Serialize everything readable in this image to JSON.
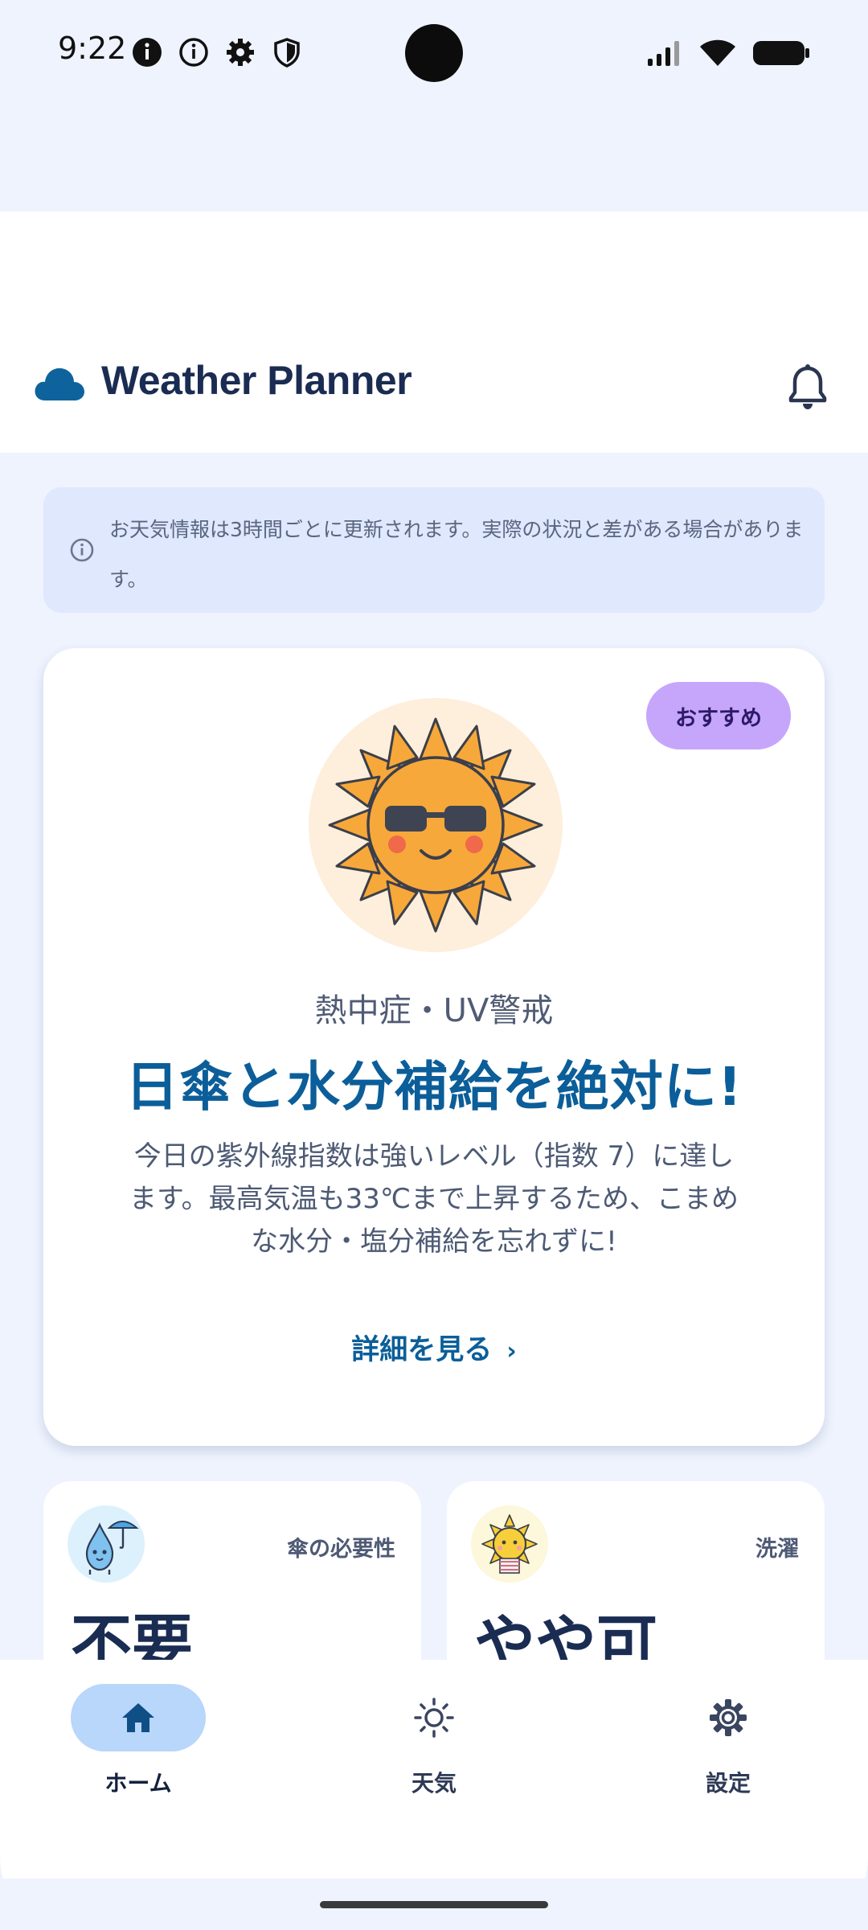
{
  "status_bar": {
    "time": "9:22",
    "left_icons": [
      "info-filled-icon",
      "info-outline-icon",
      "gear-icon",
      "shield-icon"
    ],
    "right_icons": [
      "signal-icon",
      "wifi-icon",
      "battery-icon"
    ]
  },
  "app_bar": {
    "title": "Weather Planner",
    "logo_icon": "cloud-icon",
    "notification_icon": "bell-icon"
  },
  "info_banner": {
    "icon": "info-outline-icon",
    "text": "お天気情報は3時間ごとに更新されます。実際の状況と差がある場合があります。"
  },
  "hero_card": {
    "badge": "おすすめ",
    "illustration": "sun-with-sunglasses-icon",
    "category": "熱中症・UV警戒",
    "headline": "日傘と水分補給を絶対に!",
    "body": "今日の紫外線指数は強いレベル（指数 7）に達します。最高気温も33℃まで上昇するため、こまめな水分・塩分補給を忘れずに!",
    "link_label": "詳細を見る"
  },
  "cards": [
    {
      "label": "傘の必要性",
      "value": "不要",
      "icon": "raindrop-umbrella-icon"
    },
    {
      "label": "洗濯",
      "value": "やや可",
      "icon": "sun-laundry-icon"
    }
  ],
  "bottom_nav": {
    "items": [
      {
        "label": "ホーム",
        "icon": "home-icon",
        "selected": true
      },
      {
        "label": "天気",
        "icon": "sun-outline-icon",
        "selected": false
      },
      {
        "label": "設定",
        "icon": "gear-icon",
        "selected": false
      }
    ]
  },
  "colors": {
    "primary": "#0b5e99",
    "background": "#eef3fe",
    "badge": "#c6a6fb",
    "nav_pill": "#b9d6fb",
    "banner": "#dfe8fc"
  }
}
